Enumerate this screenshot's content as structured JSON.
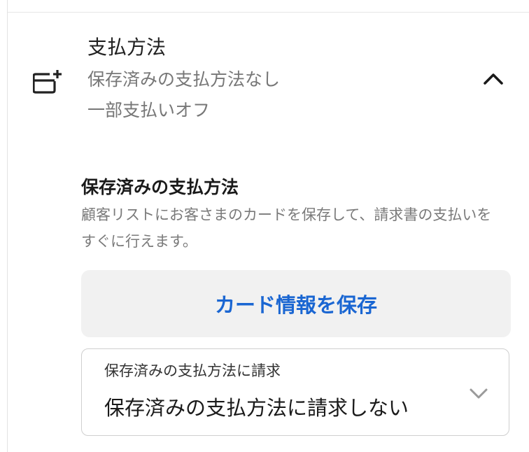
{
  "payment_section": {
    "title": "支払方法",
    "subtitle_saved": "保存済みの支払方法なし",
    "subtitle_partial": "一部支払いオフ",
    "icons": {
      "leading": "add-card-icon",
      "toggle": "chevron-up-icon"
    }
  },
  "saved_methods": {
    "title": "保存済みの支払方法",
    "description": "顧客リストにお客さまのカードを保存して、請求書の支払いをすぐに行えます。",
    "save_card_button": "カード情報を保存"
  },
  "charge_select": {
    "label": "保存済みの支払方法に請求",
    "value": "保存済みの支払方法に請求しない",
    "icon": "chevron-down-icon"
  },
  "colors": {
    "accent": "#1a66d2",
    "button_bg": "#f1f1f1",
    "muted_text": "#777777"
  }
}
